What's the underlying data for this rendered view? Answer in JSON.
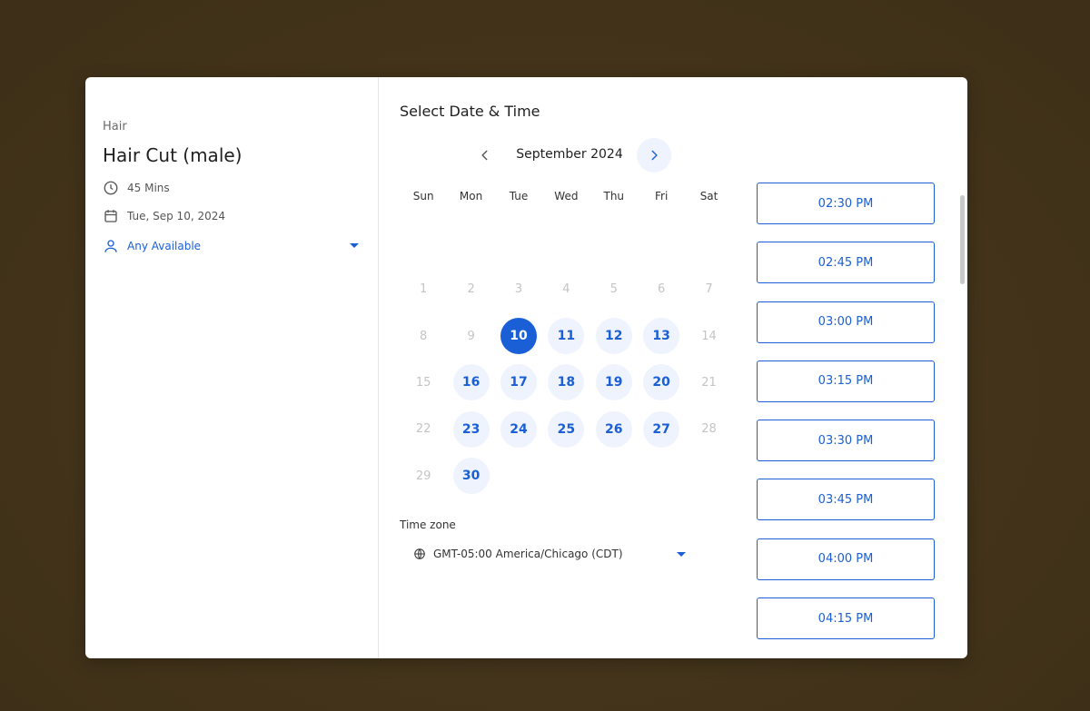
{
  "service": {
    "category": "Hair",
    "title": "Hair Cut (male)",
    "duration": "45 Mins",
    "date": "Tue, Sep 10, 2024",
    "staff": "Any Available"
  },
  "scheduler": {
    "title": "Select Date & Time",
    "month": "September 2024",
    "weekdays": [
      "Sun",
      "Mon",
      "Tue",
      "Wed",
      "Thu",
      "Fri",
      "Sat"
    ],
    "days": [
      {
        "label": "1",
        "state": "disabled"
      },
      {
        "label": "2",
        "state": "disabled"
      },
      {
        "label": "3",
        "state": "disabled"
      },
      {
        "label": "4",
        "state": "disabled"
      },
      {
        "label": "5",
        "state": "disabled"
      },
      {
        "label": "6",
        "state": "disabled"
      },
      {
        "label": "7",
        "state": "disabled"
      },
      {
        "label": "8",
        "state": "disabled"
      },
      {
        "label": "9",
        "state": "disabled"
      },
      {
        "label": "10",
        "state": "selected"
      },
      {
        "label": "11",
        "state": "available"
      },
      {
        "label": "12",
        "state": "available"
      },
      {
        "label": "13",
        "state": "available"
      },
      {
        "label": "14",
        "state": "disabled"
      },
      {
        "label": "15",
        "state": "disabled"
      },
      {
        "label": "16",
        "state": "available"
      },
      {
        "label": "17",
        "state": "available"
      },
      {
        "label": "18",
        "state": "available"
      },
      {
        "label": "19",
        "state": "available"
      },
      {
        "label": "20",
        "state": "available"
      },
      {
        "label": "21",
        "state": "disabled"
      },
      {
        "label": "22",
        "state": "disabled"
      },
      {
        "label": "23",
        "state": "available"
      },
      {
        "label": "24",
        "state": "available"
      },
      {
        "label": "25",
        "state": "available"
      },
      {
        "label": "26",
        "state": "available"
      },
      {
        "label": "27",
        "state": "available"
      },
      {
        "label": "28",
        "state": "disabled"
      },
      {
        "label": "29",
        "state": "disabled"
      },
      {
        "label": "30",
        "state": "available"
      }
    ],
    "timezone_label": "Time zone",
    "timezone_value": "GMT-05:00 America/Chicago (CDT)",
    "time_slots": [
      "02:30 PM",
      "02:45 PM",
      "03:00 PM",
      "03:15 PM",
      "03:30 PM",
      "03:45 PM",
      "04:00 PM",
      "04:15 PM"
    ]
  },
  "colors": {
    "accent": "#1a5fd6",
    "accent_light": "#eef3fd",
    "backdrop": "#45361f"
  },
  "icons": {
    "duration": "clock-icon",
    "date": "calendar-icon",
    "staff": "user-icon",
    "timezone": "globe-icon",
    "prev_month": "chevron-left-icon",
    "next_month": "chevron-right-icon"
  }
}
